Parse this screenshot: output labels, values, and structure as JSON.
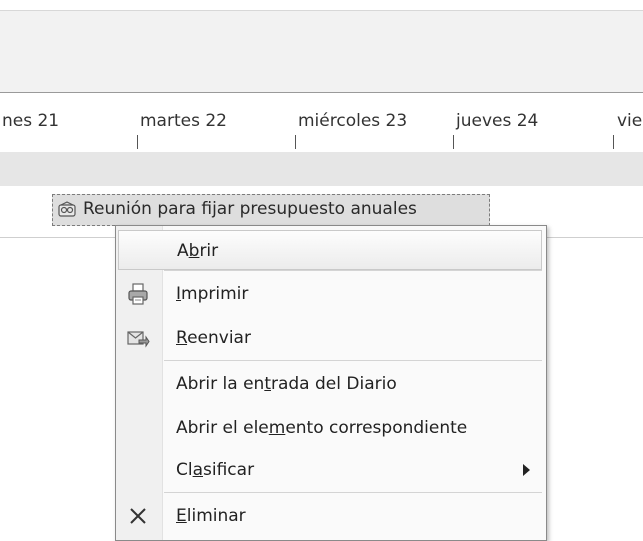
{
  "calendar": {
    "days": [
      "nes 21",
      "martes 22",
      "miércoles 23",
      "jueves 24",
      "vie"
    ],
    "appointment": {
      "title": "Reunión para fijar presupuesto anuales"
    }
  },
  "context_menu": {
    "items": [
      {
        "label": "Abrir",
        "accel_before": "A",
        "accel": "b",
        "accel_after": "rir",
        "icon": ""
      },
      {
        "label": "Imprimir",
        "accel_before": "",
        "accel": "I",
        "accel_after": "mprimir",
        "icon": "printer-icon"
      },
      {
        "label": "Reenviar",
        "accel_before": "",
        "accel": "R",
        "accel_after": "eenviar",
        "icon": "forward-icon"
      },
      {
        "label": "Abrir la entrada del Diario",
        "accel_before": "Abrir la en",
        "accel": "t",
        "accel_after": "rada del Diario",
        "icon": ""
      },
      {
        "label": "Abrir el elemento correspondiente",
        "accel_before": "Abrir el ele",
        "accel": "m",
        "accel_after": "ento correspondiente",
        "icon": ""
      },
      {
        "label": "Clasificar",
        "accel_before": "Cl",
        "accel": "a",
        "accel_after": "sificar",
        "icon": ""
      },
      {
        "label": "Eliminar",
        "accel_before": "",
        "accel": "E",
        "accel_after": "liminar",
        "icon": "delete-icon"
      }
    ]
  }
}
